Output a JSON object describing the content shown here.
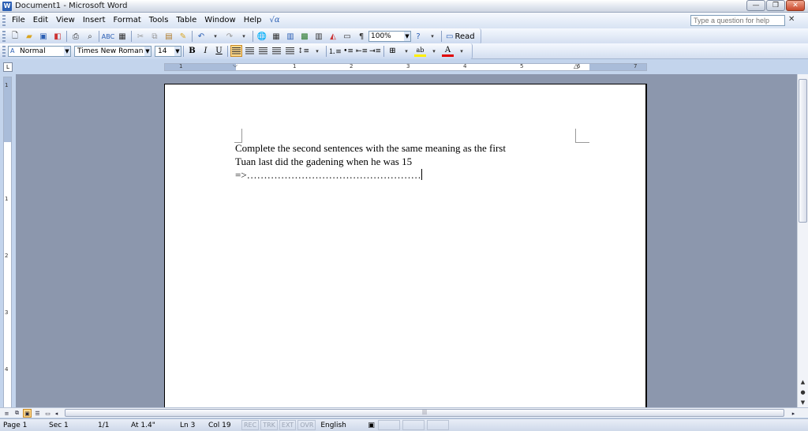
{
  "window": {
    "title": "Document1 - Microsoft Word",
    "app_icon": "word-doc-icon",
    "minimize_glyph": "—",
    "restore_glyph": "❐",
    "close_glyph": "✕"
  },
  "menu": {
    "items": [
      "File",
      "Edit",
      "View",
      "Insert",
      "Format",
      "Tools",
      "Table",
      "Window",
      "Help"
    ],
    "help_placeholder": "Type a question for help",
    "help_close_glyph": "✕"
  },
  "standard_toolbar": {
    "zoom": "100%",
    "read_label": "Read"
  },
  "formatting_toolbar": {
    "style": "Normal",
    "font": "Times New Roman",
    "size": "14",
    "bold": "B",
    "italic": "I",
    "underline": "U"
  },
  "ruler": {
    "h_numbers": [
      "1",
      "1",
      "2",
      "3",
      "4",
      "5",
      "6",
      "7"
    ],
    "v_numbers": [
      "1",
      "1",
      "2",
      "3",
      "4"
    ]
  },
  "document": {
    "lines": [
      "Complete the second sentences with the same meaning as the first",
      "Tuan last did the gadening when he was 15",
      "=>……………………………………………"
    ]
  },
  "status": {
    "page": "Page 1",
    "sec": "Sec 1",
    "pages": "1/1",
    "at": "At 1.4\"",
    "ln": "Ln 3",
    "col": "Col 19",
    "rec": "REC",
    "trk": "TRK",
    "ext": "EXT",
    "ovr": "OVR",
    "language": "English (U.S."
  },
  "colors": {
    "accent": "#2b5fb4",
    "workspace": "#8c97ad",
    "toolbar_bg": "#d3def0"
  }
}
